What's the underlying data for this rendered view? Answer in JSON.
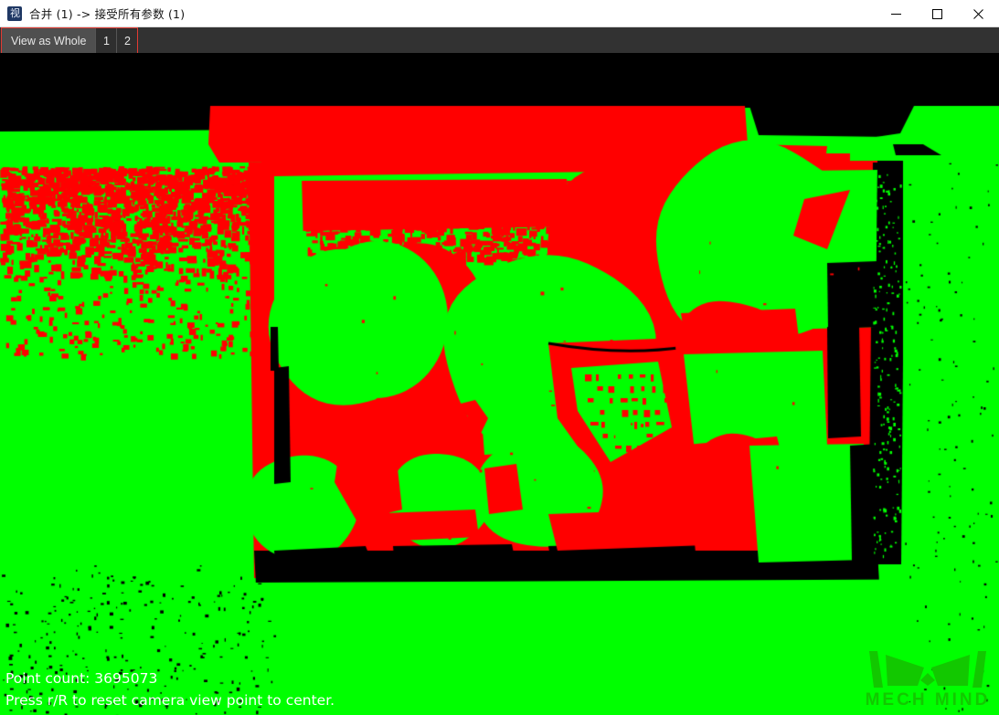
{
  "window": {
    "title": "合并 (1) -> 接受所有参数 (1)",
    "icon": "app-icon",
    "controls": {
      "minimize": "minimize-icon",
      "maximize": "maximize-icon",
      "close": "close-icon"
    }
  },
  "toolbar": {
    "view_as_whole_label": "View as Whole",
    "button_1_label": "1",
    "button_2_label": "2",
    "highlight_color": "#e23a32"
  },
  "viewport": {
    "background_color": "#000000",
    "point_colors": {
      "valid": "#00FF00",
      "invalid": "#FF0000",
      "empty": "#000000"
    }
  },
  "hud": {
    "point_count_label": "Point count: 3695073",
    "reset_hint": "Press r/R to reset camera view point to center.",
    "text_color": "#FFFFFF"
  },
  "watermark": {
    "brand": "MECH MIND",
    "color": "#12c800"
  }
}
